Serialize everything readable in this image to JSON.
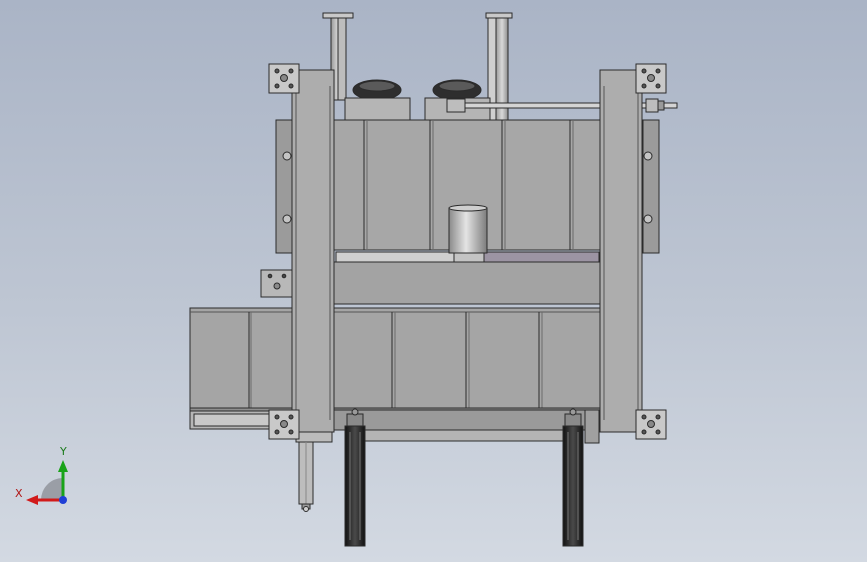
{
  "triad": {
    "x_label": "X",
    "y_label": "Y",
    "colors": {
      "x": "#d11a1a",
      "y": "#19a319",
      "z": "#1f3fd6",
      "origin_disc": "#9a9ea6"
    }
  },
  "model": {
    "colors": {
      "frame": "#adadad",
      "frame_dark": "#8f8f8f",
      "panel": "#a7a7a7",
      "panel_light": "#bcbcbc",
      "outline": "#2b2b2b",
      "plate": "#c9c9c9",
      "rail_gray": "#cfcfcf",
      "rail_purple": "#9c94a3",
      "cylinder": "#202020",
      "motor": "#2e2e2e"
    }
  }
}
